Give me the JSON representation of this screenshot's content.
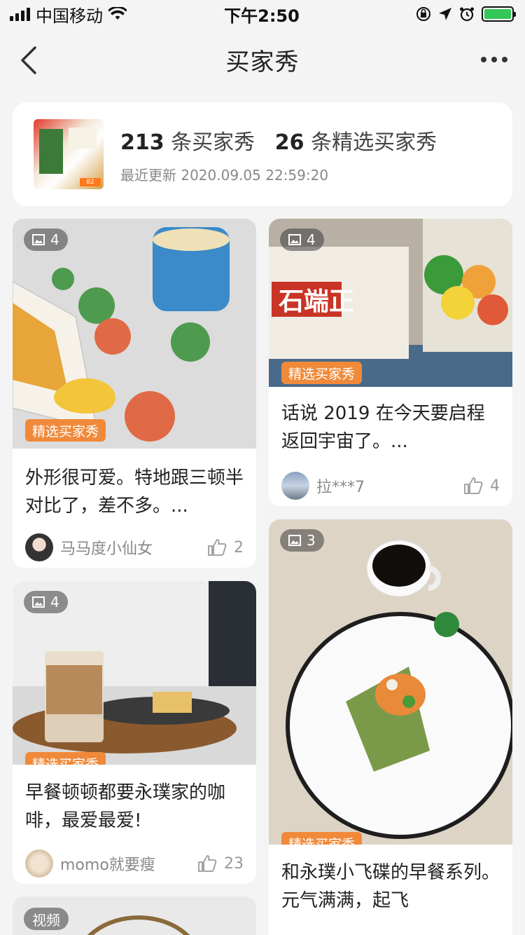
{
  "status_bar": {
    "carrier": "中国移动",
    "time": "下午2:50"
  },
  "nav": {
    "title": "买家秀",
    "back_icon": "chevron-left-icon",
    "more_icon": "more-horizontal-icon"
  },
  "summary": {
    "count": "213",
    "count_label": "条买家秀",
    "featured_count": "26",
    "featured_label": "条精选买家秀",
    "updated": "最近更新 2020.09.05 22:59:20",
    "thumb_price": "82"
  },
  "badge_label": "精选买家秀",
  "cards": [
    {
      "img_count": "4",
      "text": "外形很可爱。特地跟三顿半对比了，差不多。...",
      "user": "马马度小仙女",
      "likes": "2"
    },
    {
      "img_count": "4",
      "text": "话说 2019 在今天要启程返回宇宙了。...",
      "user": "拉***7",
      "likes": "4"
    },
    {
      "img_count": "4",
      "text": "早餐顿顿都要永璞家的咖啡，最爱最爱!",
      "user": "momo就要瘦",
      "likes": "23"
    },
    {
      "img_count": "3",
      "text": "和永璞小飞碟的早餐系列。元气满满，起飞",
      "user": "",
      "likes": ""
    },
    {
      "img_count": "视频"
    }
  ],
  "colors": {
    "badge": "#f08a3a",
    "background": "#f4f4f4",
    "battery": "#34c759"
  }
}
